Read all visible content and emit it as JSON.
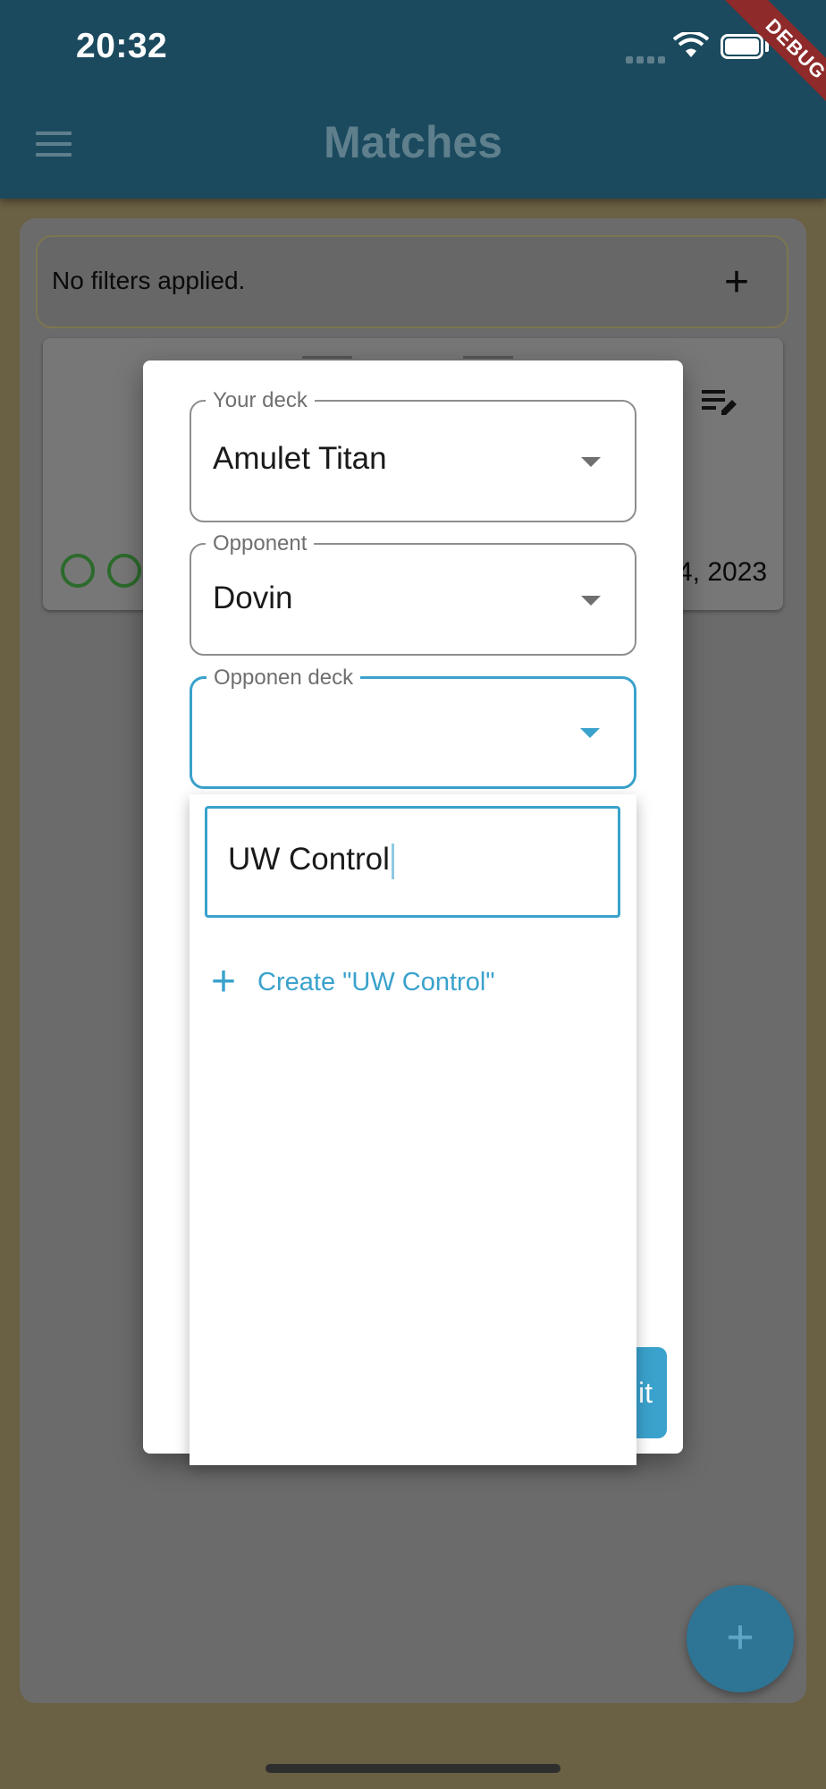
{
  "status_bar": {
    "time": "20:32"
  },
  "app_bar": {
    "title": "Matches",
    "debug_banner": "DEBUG"
  },
  "filters": {
    "text": "No filters applied."
  },
  "match_card": {
    "date": "4, 2023"
  },
  "dialog": {
    "your_deck": {
      "label": "Your deck",
      "value": "Amulet Titan"
    },
    "opponent": {
      "label": "Opponent",
      "value": "Dovin"
    },
    "opponent_deck": {
      "label": "Opponen deck",
      "value": ""
    },
    "submit_label_partial": "it"
  },
  "dropdown": {
    "search_value": "UW Control",
    "create_option": "Create \"UW Control\""
  },
  "colors": {
    "app_bar": "#1b4a5e",
    "accent": "#3aa2cc",
    "scrim_background": "#6a6043",
    "win_circle": "#2c6a2c",
    "debug_ribbon": "#8e2a2a"
  },
  "icons": {
    "menu": "hamburger-icon",
    "filter_add": "plus-icon",
    "edit": "edit-list-icon",
    "dropdown": "caret-down-icon",
    "create": "plus-icon",
    "fab": "plus-icon"
  }
}
